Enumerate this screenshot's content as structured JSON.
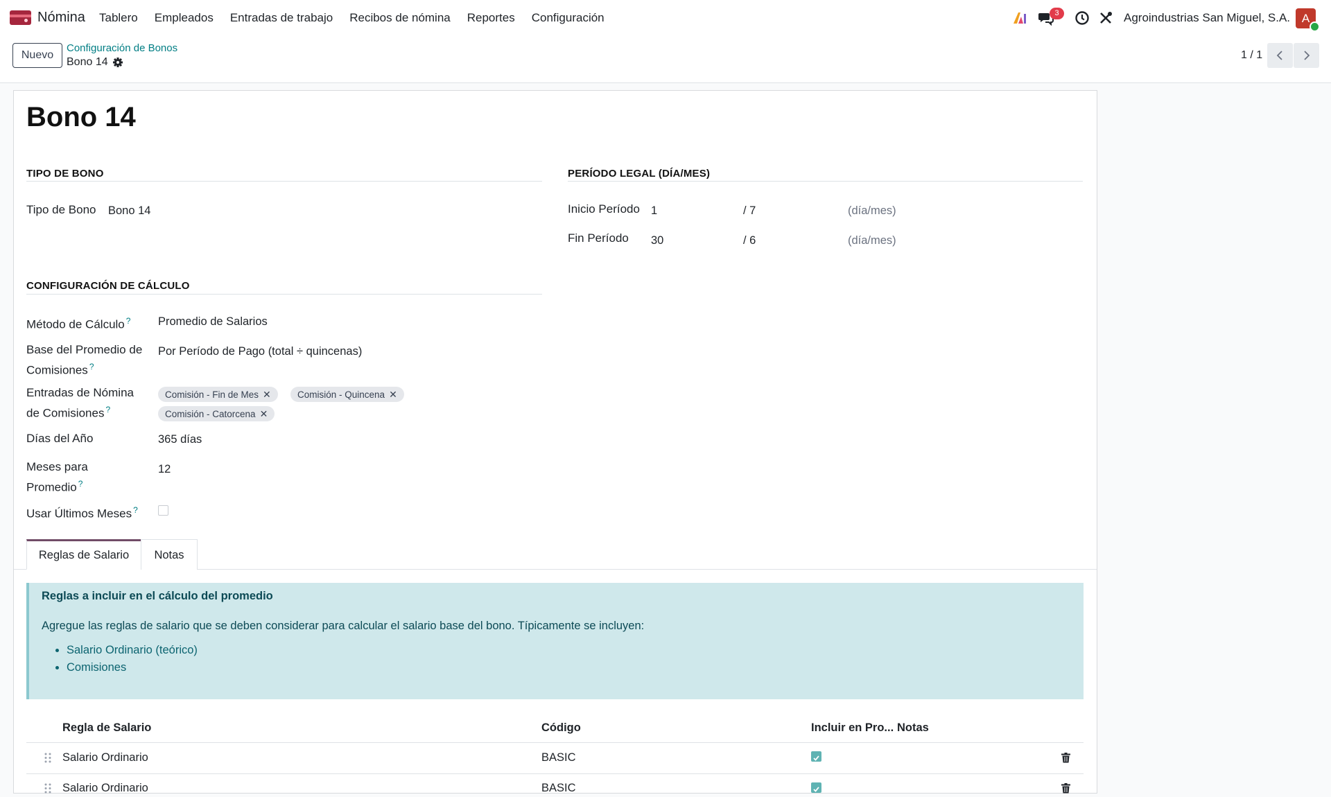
{
  "navbar": {
    "app_name": "Nómina",
    "menu": [
      "Tablero",
      "Empleados",
      "Entradas de trabajo",
      "Recibos de nómina",
      "Reportes",
      "Configuración"
    ],
    "messages_badge": "3",
    "company": "Agroindustrias San Miguel, S.A.",
    "avatar_letter": "A"
  },
  "control": {
    "new_button": "Nuevo",
    "breadcrumb_parent": "Configuración de Bonos",
    "breadcrumb_current": "Bono 14",
    "pager": "1 / 1"
  },
  "form": {
    "title": "Bono 14",
    "sections": {
      "tipo": "TIPO DE BONO",
      "periodo": "PERÍODO LEGAL (DÍA/MES)",
      "calculo": "CONFIGURACIÓN DE CÁLCULO"
    },
    "tipo_bono": {
      "label": "Tipo de Bono",
      "value": "Bono 14"
    },
    "inicio": {
      "label": "Inicio Período",
      "day": "1",
      "month": "/ 7",
      "hint": "(día/mes)"
    },
    "fin": {
      "label": "Fin Período",
      "day": "30",
      "month": "/ 6",
      "hint": "(día/mes)"
    },
    "metodo": {
      "label": "Método de Cálculo",
      "value": "Promedio de Salarios"
    },
    "base": {
      "label_1": "Base del Promedio de",
      "label_2": "Comisiones",
      "value": "Por Período de Pago (total ÷ quincenas)"
    },
    "entradas": {
      "label_1": "Entradas de Nómina",
      "label_2": "de Comisiones",
      "tags": [
        "Comisión - Fin de Mes",
        "Comisión - Quincena",
        "Comisión - Catorcena"
      ]
    },
    "dias": {
      "label": "Días del Año",
      "value": "365 días"
    },
    "meses": {
      "label_1": "Meses para",
      "label_2": "Promedio",
      "value": "12"
    },
    "ultimos": {
      "label": "Usar Últimos Meses",
      "checked": false
    },
    "help_mark": "?"
  },
  "tabs": [
    "Reglas de Salario",
    "Notas"
  ],
  "alert": {
    "title": "Reglas a incluir en el cálculo del promedio",
    "text": "Agregue las reglas de salario que se deben considerar para calcular el salario base del bono. Típicamente se incluyen:",
    "items": [
      "Salario Ordinario (teórico)",
      "Comisiones"
    ]
  },
  "table": {
    "headers": [
      "Regla de Salario",
      "Código",
      "Incluir en Pro...",
      "Notas"
    ],
    "rows": [
      {
        "rule": "Salario Ordinario",
        "code": "BASIC",
        "include": true
      },
      {
        "rule": "Salario Ordinario",
        "code": "BASIC",
        "include": true
      }
    ]
  },
  "colors": {
    "brand": "#714b67",
    "link": "#017e84",
    "alert_bg": "#cfe8eb",
    "badge": "#e23b4a"
  }
}
